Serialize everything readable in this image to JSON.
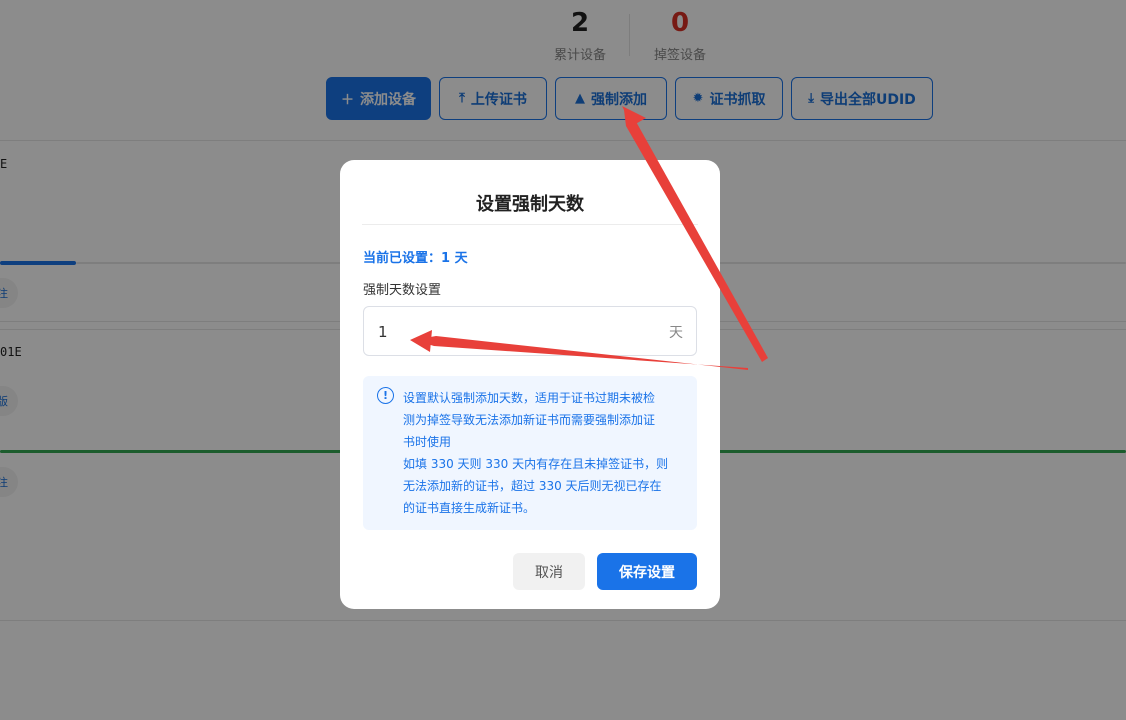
{
  "stats": {
    "total": {
      "value": "2",
      "label": "累计设备"
    },
    "lost": {
      "value": "0",
      "label": "掉签设备"
    }
  },
  "toolbar": {
    "add_device": "添加设备",
    "upload_cert": "上传证书",
    "force_add": "强制添加",
    "cert_fetch": "证书抓取",
    "export_udid": "导出全部UDID"
  },
  "rows": {
    "row1_id": "E",
    "row1_badge": "注",
    "row2_id": "01E",
    "row2_badge": "版",
    "row3_badge": "注"
  },
  "modal": {
    "title": "设置强制天数",
    "current": "当前已设置：1 天",
    "field_label": "强制天数设置",
    "days_value": "1",
    "unit": "天",
    "info_lines": [
      "设置默认强制添加天数，适用于证书过期未被检",
      "测为掉签导致无法添加新证书而需要强制添加证",
      "书时使用",
      "如填 330 天则 330 天内有存在且未掉签证书，则",
      "无法添加新的证书，超过 330 天后则无视已存在",
      "的证书直接生成新证书。"
    ],
    "cancel": "取消",
    "save": "保存设置"
  },
  "colors": {
    "primary": "#1a73e8",
    "danger": "#d93025",
    "annotation_arrow": "#e8403a",
    "progress_blue": "#1a73e8",
    "progress_green": "#34a853"
  }
}
